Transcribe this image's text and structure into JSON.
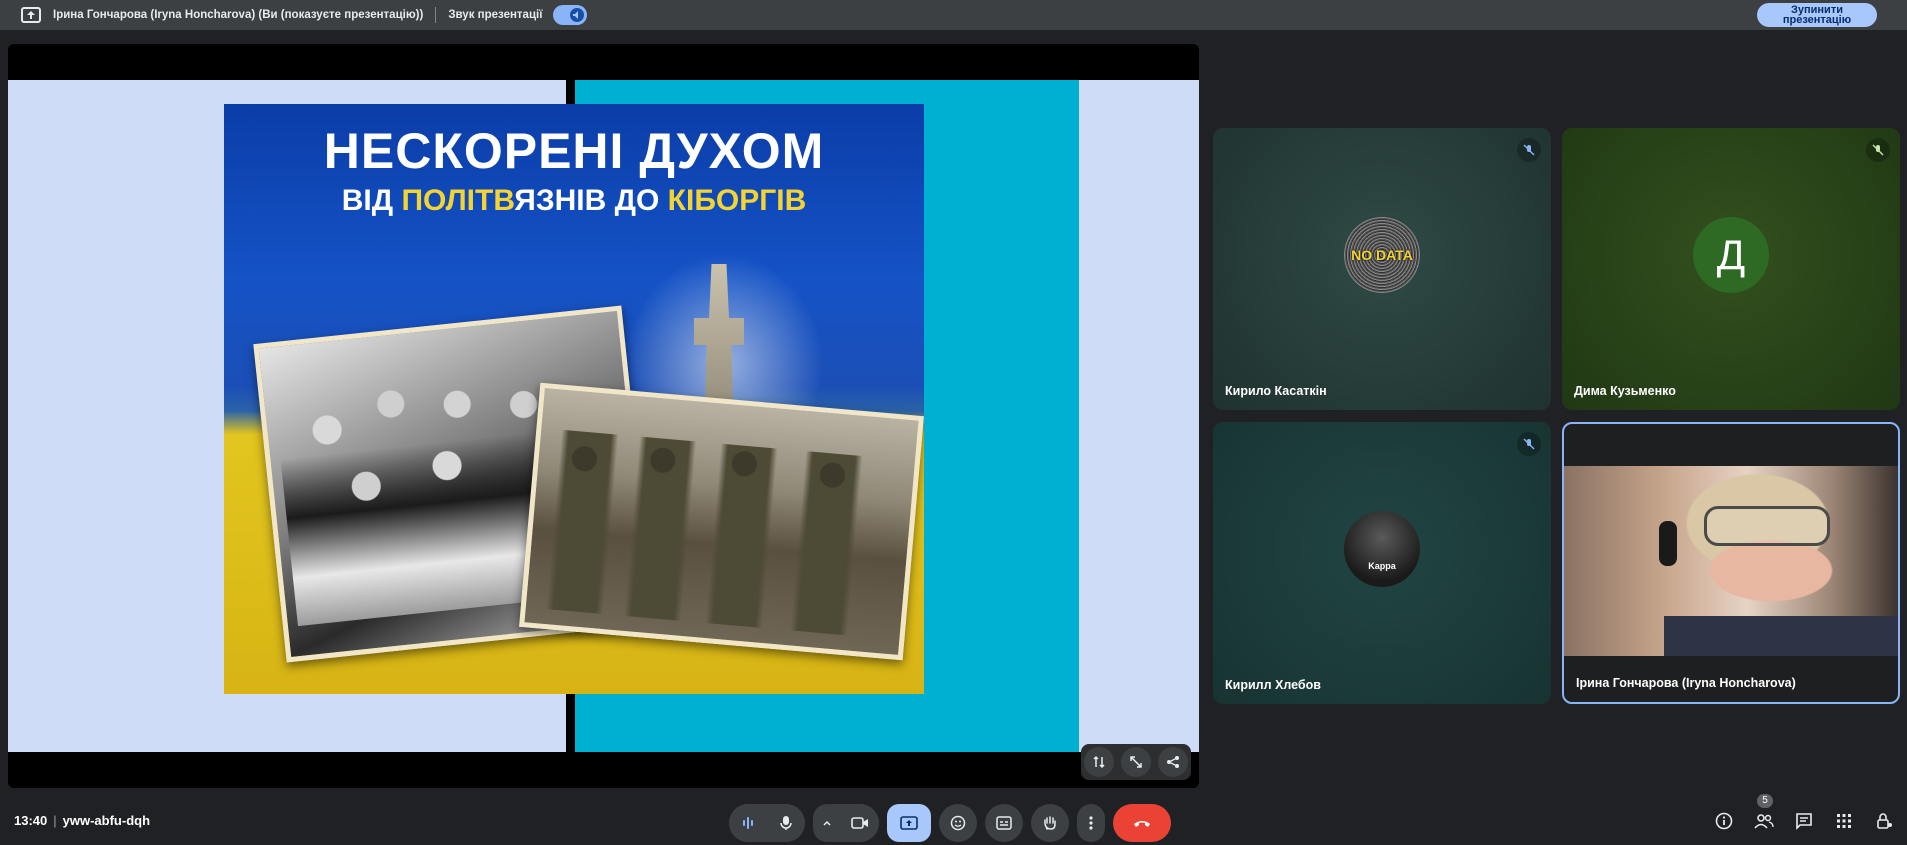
{
  "topbar": {
    "presenter_label": "Ірина Гончарова (Iryna Honcharova) (Ви (показуєте презентацію))",
    "sound_label": "Звук презентації",
    "sound_toggle_on": true,
    "stop_button": "Зупинити презентацію"
  },
  "slide": {
    "title": "НЕСКОРЕНІ ДУХОМ",
    "subtitle_parts": [
      "ВІД ",
      "ПОЛІТВ",
      "ЯЗНІВ ДО ",
      "КІБОРГІВ"
    ]
  },
  "participants": [
    {
      "name": "Кирило Касаткін",
      "avatar_text": "NO DATA",
      "muted": true
    },
    {
      "name": "Дима Кузьменко",
      "avatar_text": "Д",
      "muted": true
    },
    {
      "name": "Кирилл Хлебов",
      "avatar_text": "Kappa",
      "muted": true
    },
    {
      "name": "Ірина Гончарова (Iryna Honcharova)",
      "muted": false,
      "video": true
    }
  ],
  "bottombar": {
    "time": "13:40",
    "meeting_code": "yww-abfu-dqh",
    "people_count": "5"
  },
  "colors": {
    "accent": "#8ab4f8",
    "end_call": "#ea4335",
    "present_active": "#a8c7fa"
  }
}
